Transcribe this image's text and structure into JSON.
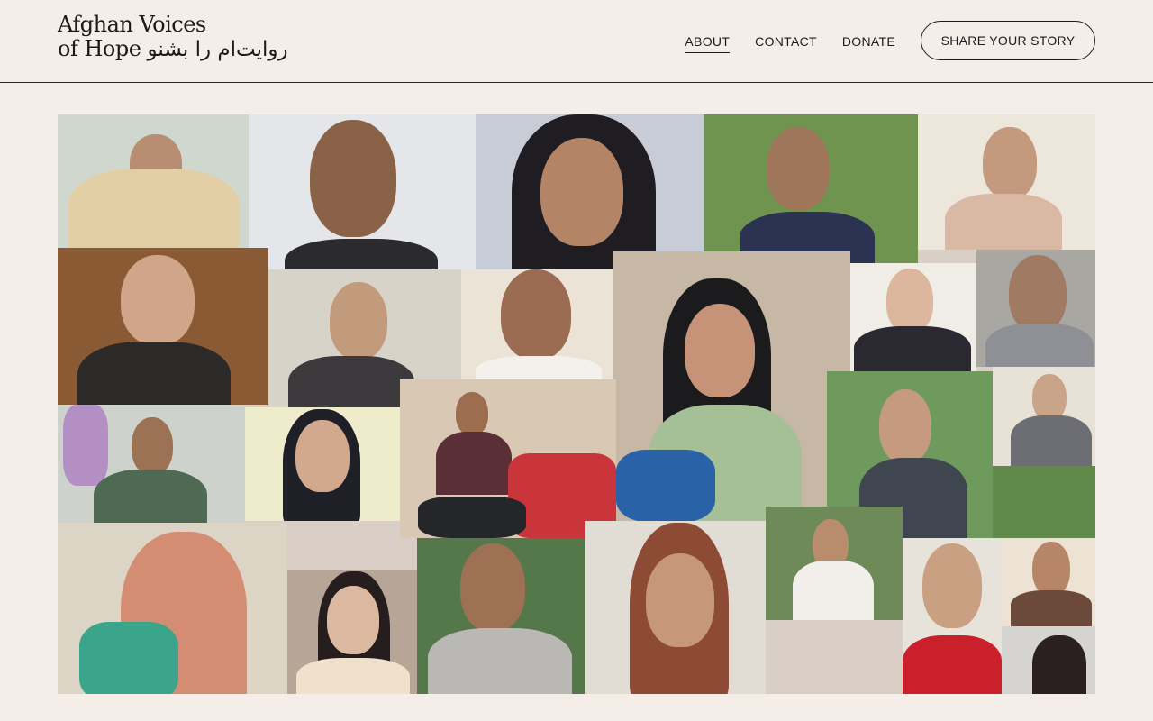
{
  "logo": {
    "line1": "Afghan Voices",
    "line2_latin": "of Hope",
    "line2_dari": "روایت‌ام را بشنو"
  },
  "nav": {
    "about": "ABOUT",
    "contact": "CONTACT",
    "donate": "DONATE",
    "cta": "SHARE YOUR STORY"
  },
  "colors": {
    "background": "#f5ede8",
    "text": "#1c1a1a"
  },
  "collage": {
    "description_count": 26
  }
}
